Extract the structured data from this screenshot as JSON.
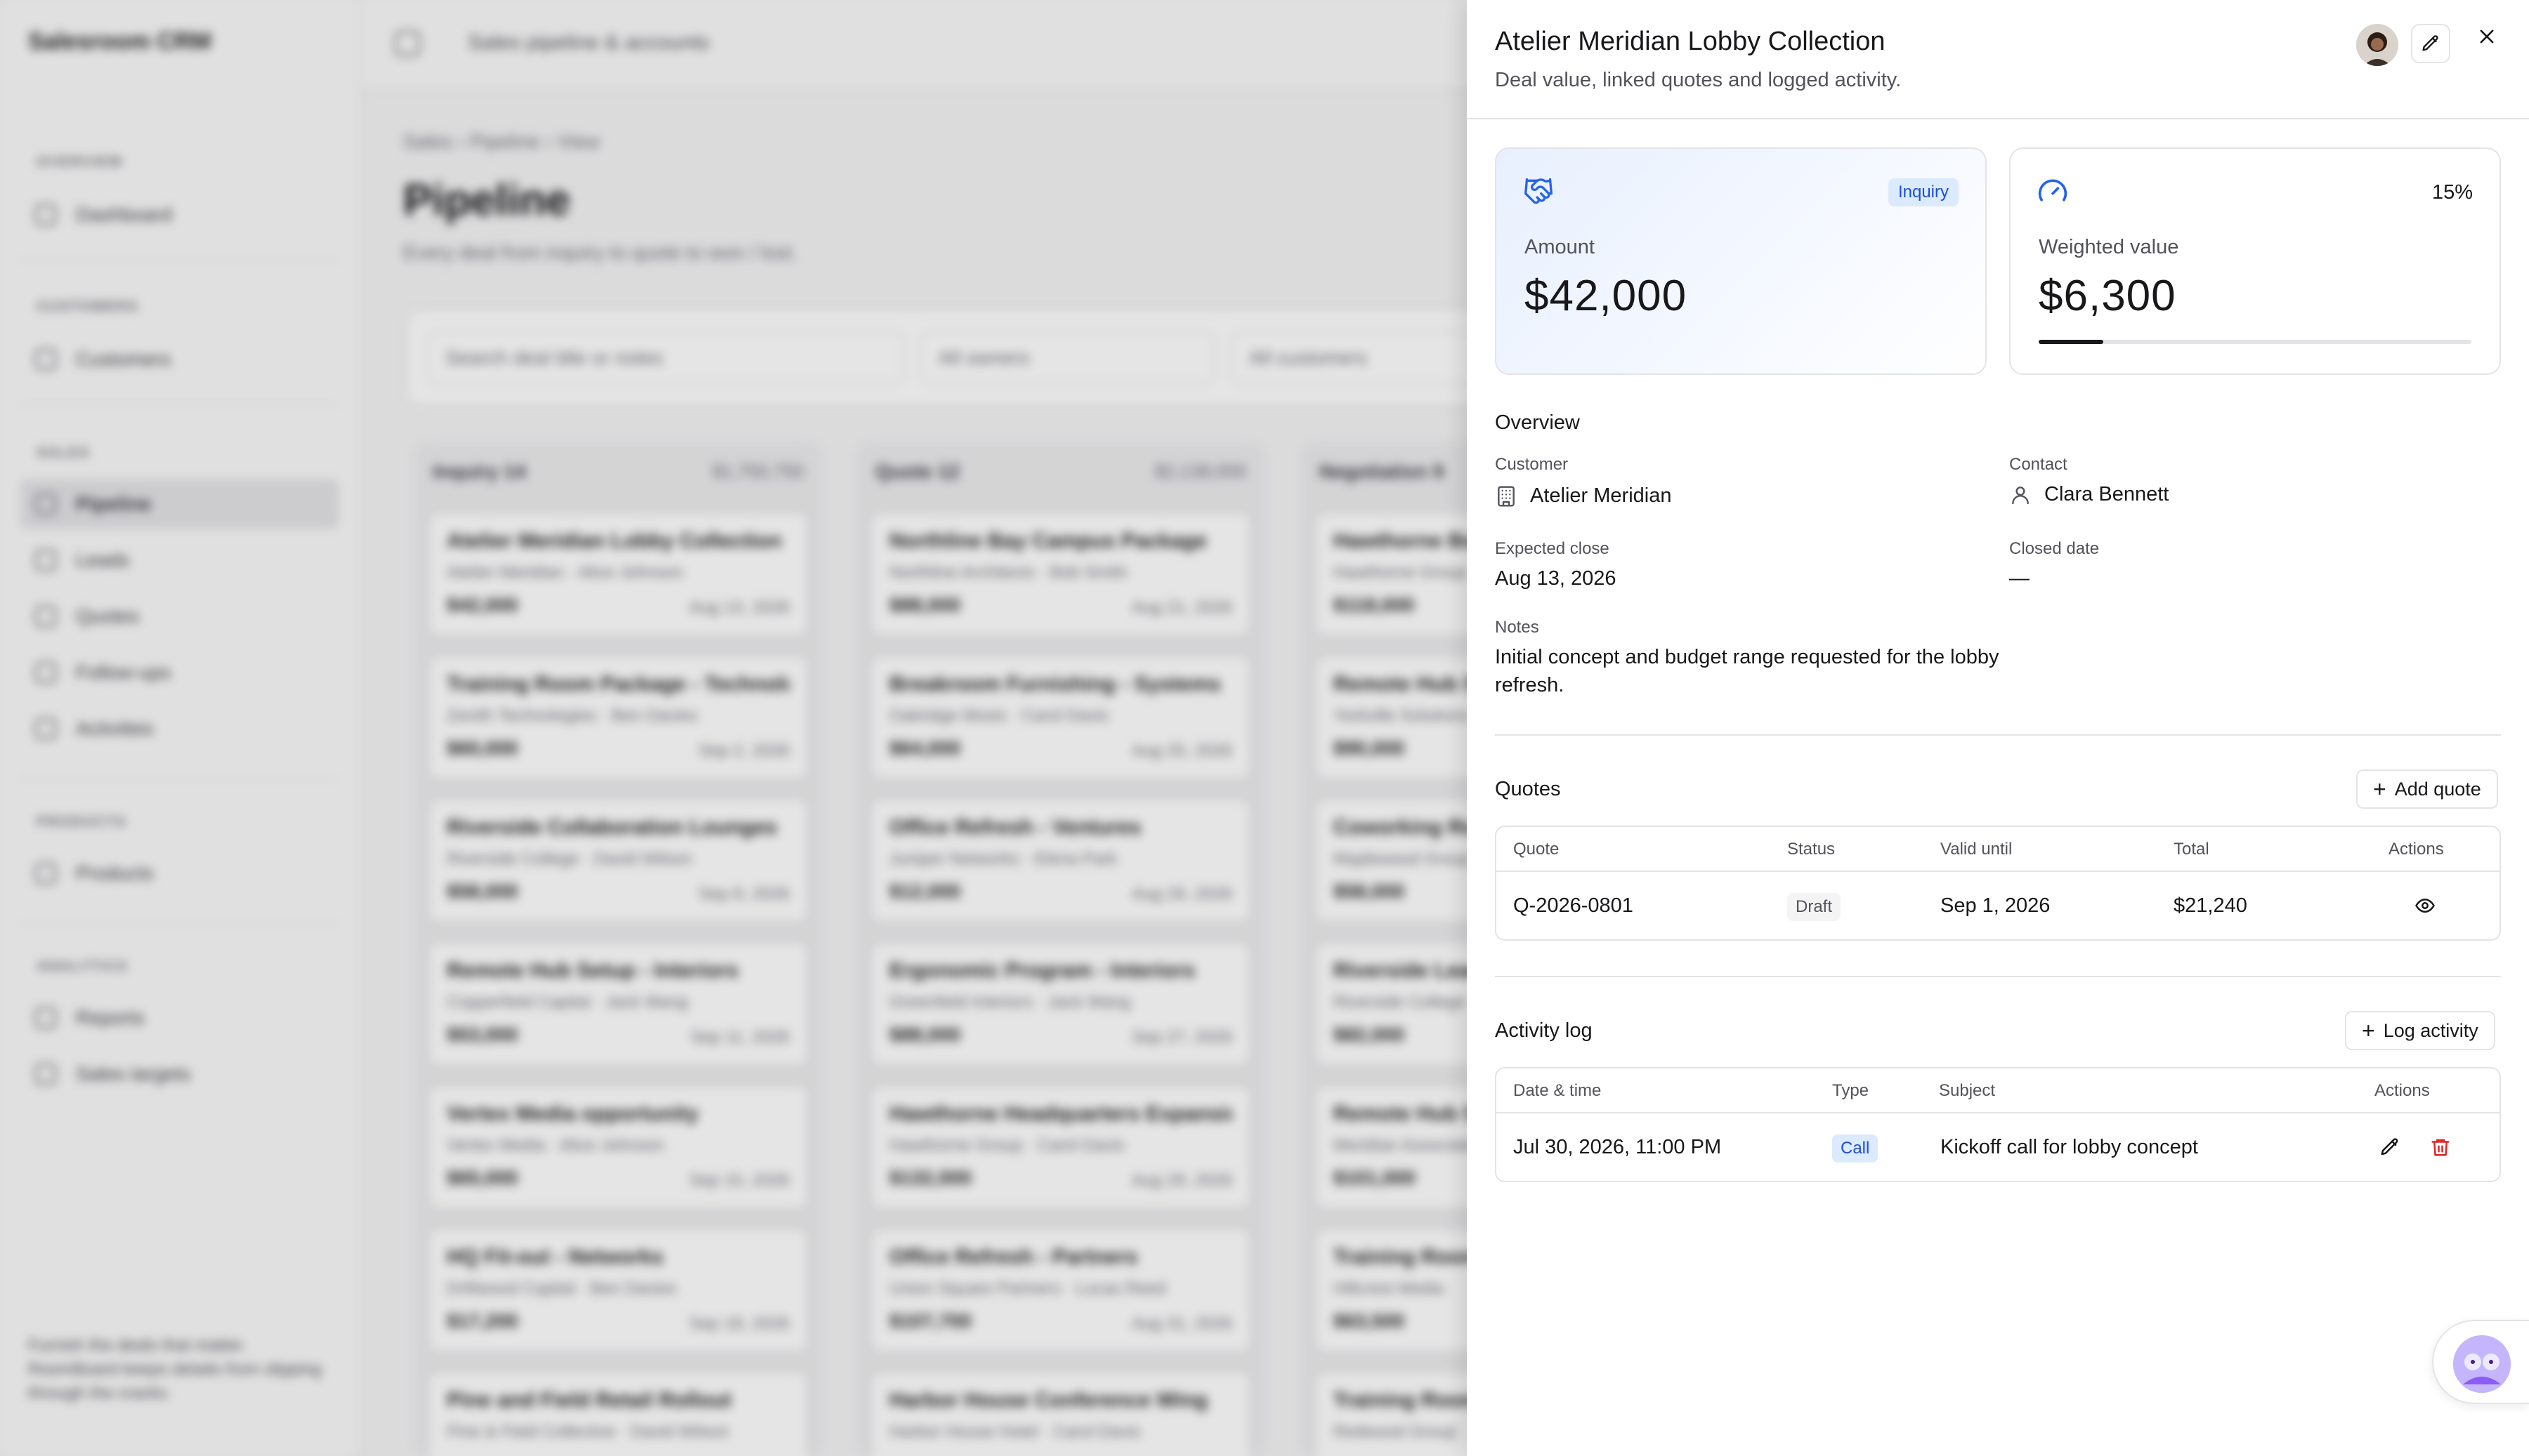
{
  "background": {
    "app_name": "Salesroom CRM",
    "topbar_title": "Sales pipeline & accounts",
    "breadcrumb": "Sales  ›  Pipeline  ›  View",
    "page_title": "Pipeline",
    "page_subtitle": "Every deal from inquiry to quote to won / lost.",
    "search_placeholder": "Search deal title or notes",
    "owners_filter": "All owners",
    "customers_filter": "All customers",
    "sidebar_groups": [
      "OVERVIEW",
      "CUSTOMERS",
      "SALES",
      "PRODUCTS",
      "ANALYTICS"
    ],
    "sidebar_items": [
      "Dashboard",
      "Customers",
      "Pipeline",
      "Leads",
      "Quotes",
      "Follow-ups",
      "Activities",
      "Products",
      "Reports",
      "Sales targets"
    ],
    "sidebar_footer": "Furnish the deals that matter. RoomBoard keeps details from slipping through the cracks.",
    "columns": [
      {
        "name": "Inquiry",
        "count": "14",
        "total": "$1,750,750",
        "cards": [
          {
            "title": "Atelier Meridian Lobby Collection",
            "sub": "Atelier Meridian · Alice Johnson",
            "amount": "$42,000",
            "date": "Aug 13, 2026"
          },
          {
            "title": "Training Room Package - Technologies",
            "sub": "Zenith Technologies · Ben Davies",
            "amount": "$60,000",
            "date": "Sep 2, 2026"
          },
          {
            "title": "Riverside Collaboration Lounges",
            "sub": "Riverside College · David Wilson",
            "amount": "$58,000",
            "date": "Sep 8, 2026"
          },
          {
            "title": "Remote Hub Setup - Interiors",
            "sub": "Copperfield Capital · Jack Wang",
            "amount": "$53,000",
            "date": "Sep 11, 2026"
          },
          {
            "title": "Vertex Media opportunity",
            "sub": "Vertex Media · Alice Johnson",
            "amount": "$65,000",
            "date": "Sep 15, 2026"
          },
          {
            "title": "HQ Fit-out - Networks",
            "sub": "Driftwood Capital · Ben Davies",
            "amount": "$17,200",
            "date": "Sep 18, 2026"
          },
          {
            "title": "Pine and Field Retail Rollout",
            "sub": "Pine & Field Collective · David Wilson",
            "amount": "",
            "date": ""
          }
        ]
      },
      {
        "name": "Quote",
        "count": "12",
        "total": "$2,138,000",
        "cards": [
          {
            "title": "Northline Bay Campus Package",
            "sub": "Northline Architects · Bob Smith",
            "amount": "$88,000",
            "date": "Aug 21, 2026"
          },
          {
            "title": "Breakroom Furnishing - Systems",
            "sub": "Oakridge Mosis · Carol Davis",
            "amount": "$64,000",
            "date": "Aug 25, 2026"
          },
          {
            "title": "Office Refresh - Ventures",
            "sub": "Juniper Networks · Elena Park",
            "amount": "$12,000",
            "date": "Aug 29, 2026"
          },
          {
            "title": "Ergonomic Program - Interiors",
            "sub": "Greenfield Interiors · Jack Wang",
            "amount": "$88,000",
            "date": "Sep 27, 2026"
          },
          {
            "title": "Hawthorne Headquarters Expansion",
            "sub": "Hawthorne Group · Carol Davis",
            "amount": "$132,000",
            "date": "Aug 29, 2026"
          },
          {
            "title": "Office Refresh - Partners",
            "sub": "Union Square Partners · Lucas Reed",
            "amount": "$107,700",
            "date": "Aug 31, 2026"
          },
          {
            "title": "Harbor House Conference Wing",
            "sub": "Harbor House Hotel · Carol Davis",
            "amount": "",
            "date": ""
          }
        ]
      },
      {
        "name": "Negotiation",
        "count": "9",
        "total": "",
        "cards": [
          {
            "title": "Hawthorne Boardroom",
            "sub": "Hawthorne Group",
            "amount": "$118,000",
            "date": ""
          },
          {
            "title": "Remote Hub Setup",
            "sub": "Yorkville Solutions",
            "amount": "$90,000",
            "date": ""
          },
          {
            "title": "Coworking Rollout",
            "sub": "Maplewood Group",
            "amount": "$58,000",
            "date": ""
          },
          {
            "title": "Riverside Learning",
            "sub": "Riverside College",
            "amount": "$82,000",
            "date": ""
          },
          {
            "title": "Remote Hub Setup",
            "sub": "Meridian Associates",
            "amount": "$101,000",
            "date": ""
          },
          {
            "title": "Training Room Refit",
            "sub": "Hillcrest Media",
            "amount": "$63,500",
            "date": ""
          },
          {
            "title": "Training Room Package",
            "sub": "Redwood Group",
            "amount": "",
            "date": ""
          }
        ]
      }
    ]
  },
  "drawer": {
    "title": "Atelier Meridian Lobby Collection",
    "subtitle": "Deal value, linked quotes and logged activity.",
    "amount_card": {
      "stage_badge": "Inquiry",
      "label": "Amount",
      "value": "$42,000"
    },
    "weighted_card": {
      "probability": "15%",
      "probability_fraction": 0.15,
      "label": "Weighted value",
      "value": "$6,300"
    },
    "overview": {
      "title": "Overview",
      "customer_label": "Customer",
      "customer_value": "Atelier Meridian",
      "contact_label": "Contact",
      "contact_value": "Clara Bennett",
      "expected_close_label": "Expected close",
      "expected_close_value": "Aug 13, 2026",
      "closed_date_label": "Closed date",
      "closed_date_value": "—",
      "notes_label": "Notes",
      "notes_value": "Initial concept and budget range requested for the lobby refresh."
    },
    "quotes": {
      "title": "Quotes",
      "add_label": "Add quote",
      "headers": {
        "quote": "Quote",
        "status": "Status",
        "valid_until": "Valid until",
        "total": "Total",
        "actions": "Actions"
      },
      "rows": [
        {
          "quote": "Q-2026-0801",
          "status": "Draft",
          "valid_until": "Sep 1, 2026",
          "total": "$21,240"
        }
      ]
    },
    "activity": {
      "title": "Activity log",
      "add_label": "Log activity",
      "headers": {
        "datetime": "Date & time",
        "type": "Type",
        "subject": "Subject",
        "actions": "Actions"
      },
      "rows": [
        {
          "datetime": "Jul 30, 2026, 11:00 PM",
          "type": "Call",
          "subject": "Kickoff call for lobby concept"
        }
      ]
    }
  },
  "icons": {
    "amount_card": "handshake-icon",
    "weighted_card": "gauge-icon",
    "customer": "building-icon",
    "contact": "user-icon",
    "edit_deal": "pencil-icon",
    "close": "close-icon",
    "view_quote": "eye-icon",
    "edit_activity": "pencil-icon",
    "delete_activity": "trash-icon",
    "help": "support-avatar-icon"
  },
  "colors": {
    "accent": "#2563eb",
    "badge_blue_bg": "#dbeafe",
    "badge_blue_text": "#1d4ed8",
    "danger": "#dc2626"
  }
}
